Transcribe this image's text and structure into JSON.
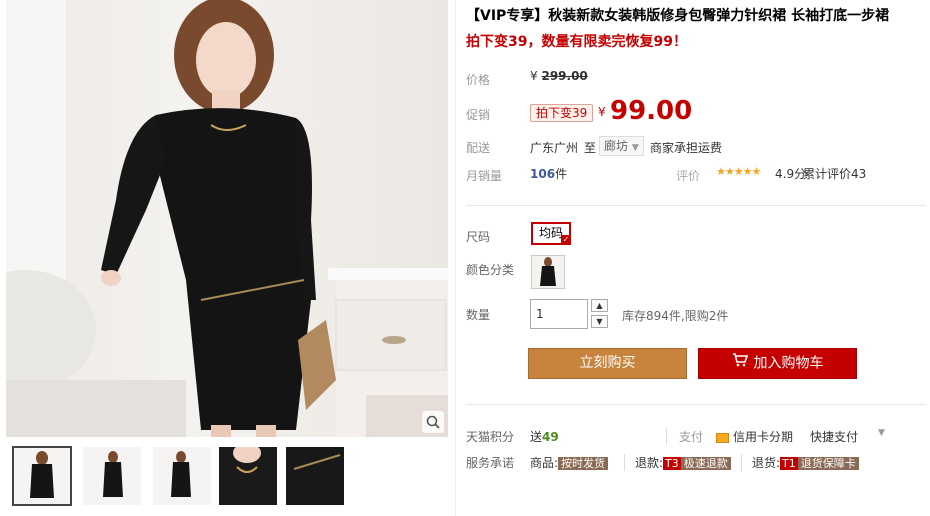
{
  "title": "【VIP专享】秋装新款女装韩版修身包臀弹力针织裙 长袖打底一步裙",
  "subtitle": "拍下变39，数量有限卖完恢复99！",
  "price": {
    "label": "价格",
    "currency": "¥",
    "original": "299.00"
  },
  "promo": {
    "label": "促销",
    "tag": "拍下变39",
    "currency": "¥",
    "price": "99.00"
  },
  "shipping": {
    "label": "配送",
    "from": "广东广州",
    "to_word": "至",
    "destination": "廊坊",
    "fee_note": "商家承担运费"
  },
  "sales": {
    "label": "月销量",
    "count": "106",
    "unit": "件",
    "rating_label": "评价",
    "stars": "★★★★★",
    "score": "4.9分",
    "reviews": "累计评价43"
  },
  "size": {
    "label": "尺码",
    "option": "均码"
  },
  "color": {
    "label": "颜色分类"
  },
  "quantity": {
    "label": "数量",
    "value": "1",
    "stock_note": "库存894件,限购2件"
  },
  "buttons": {
    "buy": "立刻购买",
    "cart": "加入购物车"
  },
  "points": {
    "label": "天猫积分",
    "prefix": "送",
    "value": "49"
  },
  "payment": {
    "label": "支付",
    "card": "信用卡分期",
    "quick": "快捷支付"
  },
  "service": {
    "label": "服务承诺",
    "goods_label": "商品:",
    "goods_tag": "按时发货",
    "refund_label": "退款:",
    "refund_code": "T3",
    "refund_tag": "极速退款",
    "return_label": "退货:",
    "return_code": "T1",
    "return_tag": "退货保障卡"
  },
  "colors": {
    "accent": "#c40000",
    "buy_button": "#c8843f",
    "cart_button": "#c40000",
    "stars": "#f5a623"
  }
}
